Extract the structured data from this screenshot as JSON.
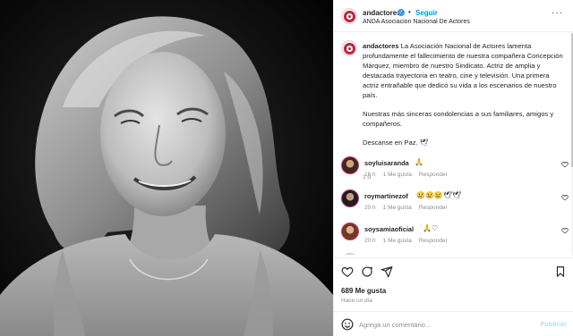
{
  "header": {
    "username": "andactores",
    "follow_label": "Seguir",
    "separator": "•",
    "subtitle": "ANDA Asociacion Nacional De Actores",
    "more": "···"
  },
  "caption": {
    "username": "andactores",
    "p1": "La Asociación Nacional de Actores lamenta profundamente el fallecimiento de nuestra compañera Concepción Márquez, miembro de nuestro Sindicato. Actriz de amplia y destacada trayectoria en teatro, cine y televisión. Una primera actriz entrañable que dedicó su vida a los escenarios de nuestro país.",
    "p2": "Nuestras más sinceras condolencias a sus familiares, amigos y compañeros.",
    "p3": "Descanse en Paz. 🕊",
    "time": "1 d"
  },
  "comments": [
    {
      "username": "soyluisaranda",
      "text": "🙏",
      "time": "16 h",
      "likes": "1 Me gusta",
      "reply": "Responder"
    },
    {
      "username": "roymartinezof",
      "text": "😢😢😢🕊🕊",
      "time": "20 h",
      "likes": "1 Me gusta",
      "reply": "Responder"
    },
    {
      "username": "soysamiaoficial",
      "text": "🙏♡",
      "time": "20 h",
      "likes": "1 Me gusta",
      "reply": "Responder"
    }
  ],
  "actions": {
    "likes": "689 Me gusta",
    "ago": "Hace un día"
  },
  "composer": {
    "placeholder": "Agrega un comentario...",
    "publish": "Publicar"
  },
  "icons": [
    "heart-icon",
    "comment-icon",
    "share-icon",
    "bookmark-icon",
    "emoji-icon",
    "verified-icon",
    "more-icon"
  ],
  "colors": {
    "link": "#0095f6",
    "brand": "#c0243f",
    "muted": "#8e8e8e",
    "verified": "#3897f0"
  }
}
